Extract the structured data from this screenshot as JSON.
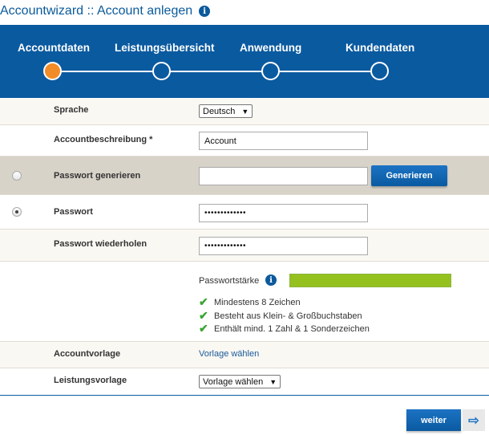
{
  "header": {
    "title": "Accountwizard :: Account anlegen",
    "info_icon": "info-icon"
  },
  "wizard": {
    "steps": [
      {
        "label": "Accountdaten",
        "active": true
      },
      {
        "label": "Leistungsübersicht",
        "active": false
      },
      {
        "label": "Anwendung",
        "active": false
      },
      {
        "label": "Kundendaten",
        "active": false
      }
    ],
    "active_color": "#f28c28",
    "bar_color": "#0a5aa0"
  },
  "form": {
    "language": {
      "label": "Sprache",
      "value": "Deutsch"
    },
    "description": {
      "label": "Accountbeschreibung *",
      "value": "Account"
    },
    "generate_password": {
      "label": "Passwort generieren",
      "value": "",
      "button": "Generieren",
      "selected": false
    },
    "password": {
      "label": "Passwort",
      "value": "•••••••••••••",
      "selected": true
    },
    "password_repeat": {
      "label": "Passwort wiederholen",
      "value": "•••••••••••••"
    },
    "strength": {
      "label": "Passwortstärke",
      "level": 1.0,
      "color": "#95c11f",
      "criteria": [
        "Mindestens 8 Zeichen",
        "Besteht aus Klein- & Großbuchstaben",
        "Enthält mind. 1 Zahl & 1 Sonderzeichen"
      ]
    },
    "account_template": {
      "label": "Accountvorlage",
      "link": "Vorlage wählen"
    },
    "service_template": {
      "label": "Leistungsvorlage",
      "value": "Vorlage wählen"
    }
  },
  "footer": {
    "next_label": "weiter"
  }
}
